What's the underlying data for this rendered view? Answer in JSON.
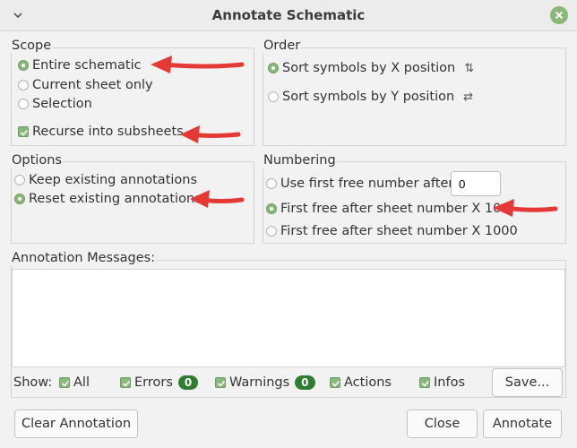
{
  "window": {
    "title": "Annotate Schematic"
  },
  "scope": {
    "label": "Scope",
    "options": [
      "Entire schematic",
      "Current sheet only",
      "Selection"
    ],
    "selected": 0,
    "recurse_label": "Recurse into subsheets"
  },
  "order": {
    "label": "Order",
    "options": [
      "Sort symbols by X position",
      "Sort symbols by Y position"
    ],
    "icons": [
      "sort-x-icon",
      "sort-y-icon"
    ],
    "selected": 0
  },
  "options": {
    "label": "Options",
    "items": [
      "Keep existing annotations",
      "Reset existing annotations"
    ],
    "selected": 1
  },
  "numbering": {
    "label": "Numbering",
    "items": [
      "Use first free number after:",
      "First free after sheet number X 100",
      "First free after sheet number X 1000"
    ],
    "selected": 1,
    "start_value": "0"
  },
  "messages": {
    "label": "Annotation Messages:",
    "show_label": "Show:",
    "filters": {
      "all": "All",
      "errors": "Errors",
      "errors_count": "0",
      "warnings": "Warnings",
      "warnings_count": "0",
      "actions": "Actions",
      "infos": "Infos"
    },
    "save_label": "Save..."
  },
  "buttons": {
    "clear": "Clear Annotation",
    "close": "Close",
    "annotate": "Annotate"
  },
  "colors": {
    "accent": "#8ab87a",
    "badge": "#2e7d32",
    "annotation_arrow": "#e53935"
  }
}
